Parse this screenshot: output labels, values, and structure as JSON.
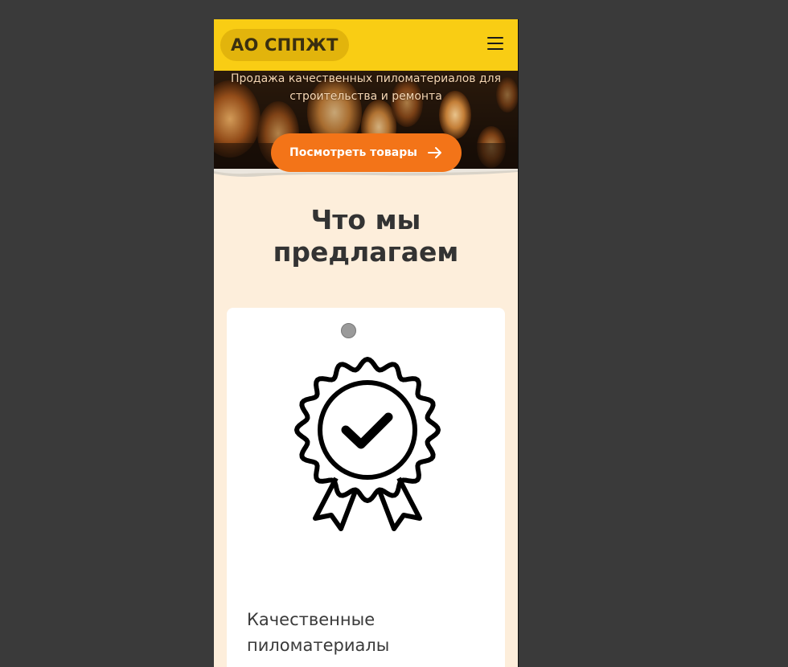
{
  "header": {
    "logo_text": "АО СППЖТ",
    "menu_icon": "hamburger-menu-icon"
  },
  "hero": {
    "subtitle_line1": "Продажа качественных пиломатериалов для",
    "subtitle_line2": "строительства и ремонта",
    "cta_label": "Посмотреть товары",
    "cta_icon": "arrow-right-icon"
  },
  "offer": {
    "title_line1": "Что мы",
    "title_line2": "предлагаем",
    "card": {
      "icon": "quality-badge-check-icon",
      "title_line1": "Качественные",
      "title_line2": "пиломатериалы"
    }
  },
  "colors": {
    "header_bg": "#f9cd14",
    "accent": "#f37418",
    "page_bg": "#fdeedb"
  }
}
